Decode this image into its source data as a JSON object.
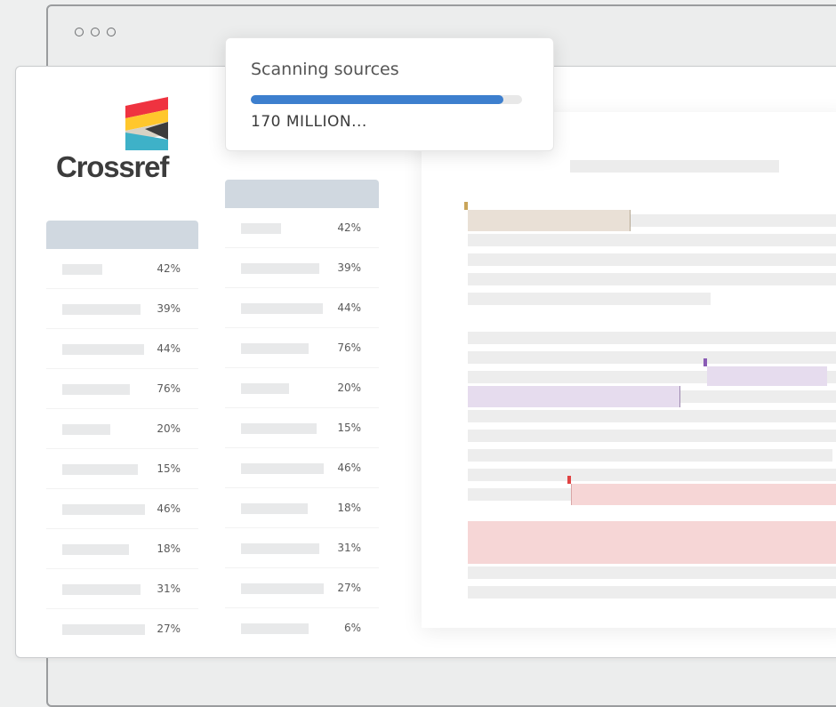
{
  "window": {
    "controls": [
      "dot",
      "dot",
      "dot"
    ]
  },
  "logo": {
    "text": "Crossref",
    "colors": [
      "#ef3340",
      "#ffc72c",
      "#3eb1c8",
      "#d8d2c4"
    ]
  },
  "scan": {
    "title": "Scanning sources",
    "status": "170 MILLION...",
    "progress": 0.93,
    "color": "#3d7fce"
  },
  "table_left": {
    "values": [
      "42%",
      "39%",
      "44%",
      "76%",
      "20%",
      "15%",
      "46%",
      "18%",
      "31%",
      "27%"
    ]
  },
  "table_right": {
    "values": [
      "42%",
      "39%",
      "44%",
      "76%",
      "20%",
      "15%",
      "46%",
      "18%",
      "31%",
      "27%",
      "6%"
    ]
  },
  "highlight_colors": {
    "tan": "#e9e0d6",
    "purple": "#e6dcee",
    "pink": "#f6d6d6"
  }
}
